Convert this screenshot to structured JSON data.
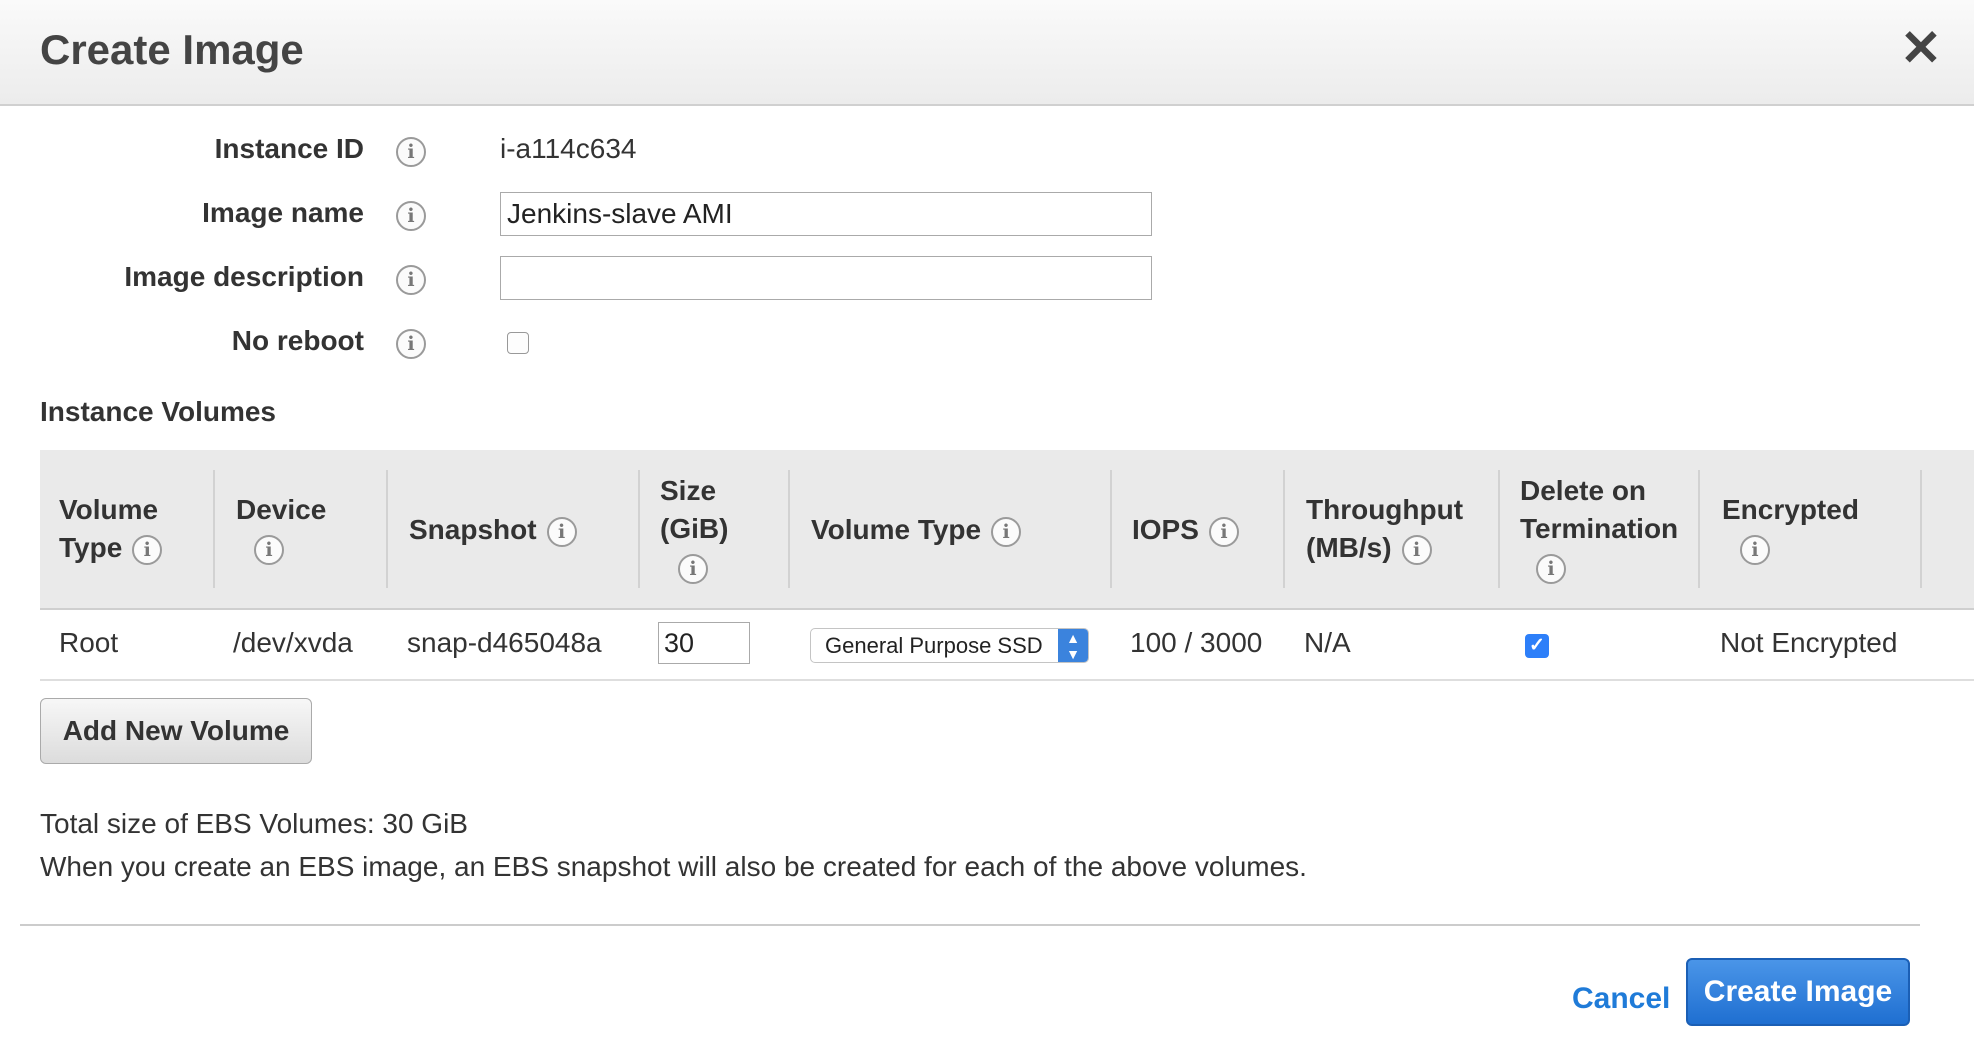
{
  "dialog": {
    "title": "Create Image",
    "close_glyph": "✕"
  },
  "form": {
    "instance_id_label": "Instance ID",
    "instance_id_value": "i-a114c634",
    "image_name_label": "Image name",
    "image_name_value": "Jenkins-slave AMI",
    "image_description_label": "Image description",
    "image_description_value": "",
    "no_reboot_label": "No reboot",
    "no_reboot_checked": false,
    "info_glyph": "i"
  },
  "volumes": {
    "section_title": "Instance Volumes",
    "headers": {
      "volume_type_1": "Volume",
      "volume_type_2": "Type",
      "device": "Device",
      "snapshot": "Snapshot",
      "size_1": "Size",
      "size_2": "(GiB)",
      "volume_type": "Volume Type",
      "iops": "IOPS",
      "throughput_1": "Throughput",
      "throughput_2": "(MB/s)",
      "delete_1": "Delete on",
      "delete_2": "Termination",
      "encrypted": "Encrypted"
    },
    "rows": [
      {
        "volume_type": "Root",
        "device": "/dev/xvda",
        "snapshot": "snap-d465048a",
        "size": "30",
        "ebs_type": "General Purpose SSD",
        "iops": "100 / 3000",
        "throughput": "N/A",
        "delete_on_termination": true,
        "check_glyph": "✓",
        "encrypted": "Not Encrypted"
      }
    ],
    "add_button": "Add New Volume"
  },
  "summary": {
    "total": "Total size of EBS Volumes: 30 GiB",
    "note": "When you create an EBS image, an EBS snapshot will also be created for each of the above volumes."
  },
  "footer": {
    "cancel": "Cancel",
    "create": "Create Image"
  },
  "colors": {
    "accent": "#1f7bd8",
    "primary_button": "#2d7ff9",
    "header_bg": "#ececec",
    "table_head_bg": "#eaeaea"
  }
}
